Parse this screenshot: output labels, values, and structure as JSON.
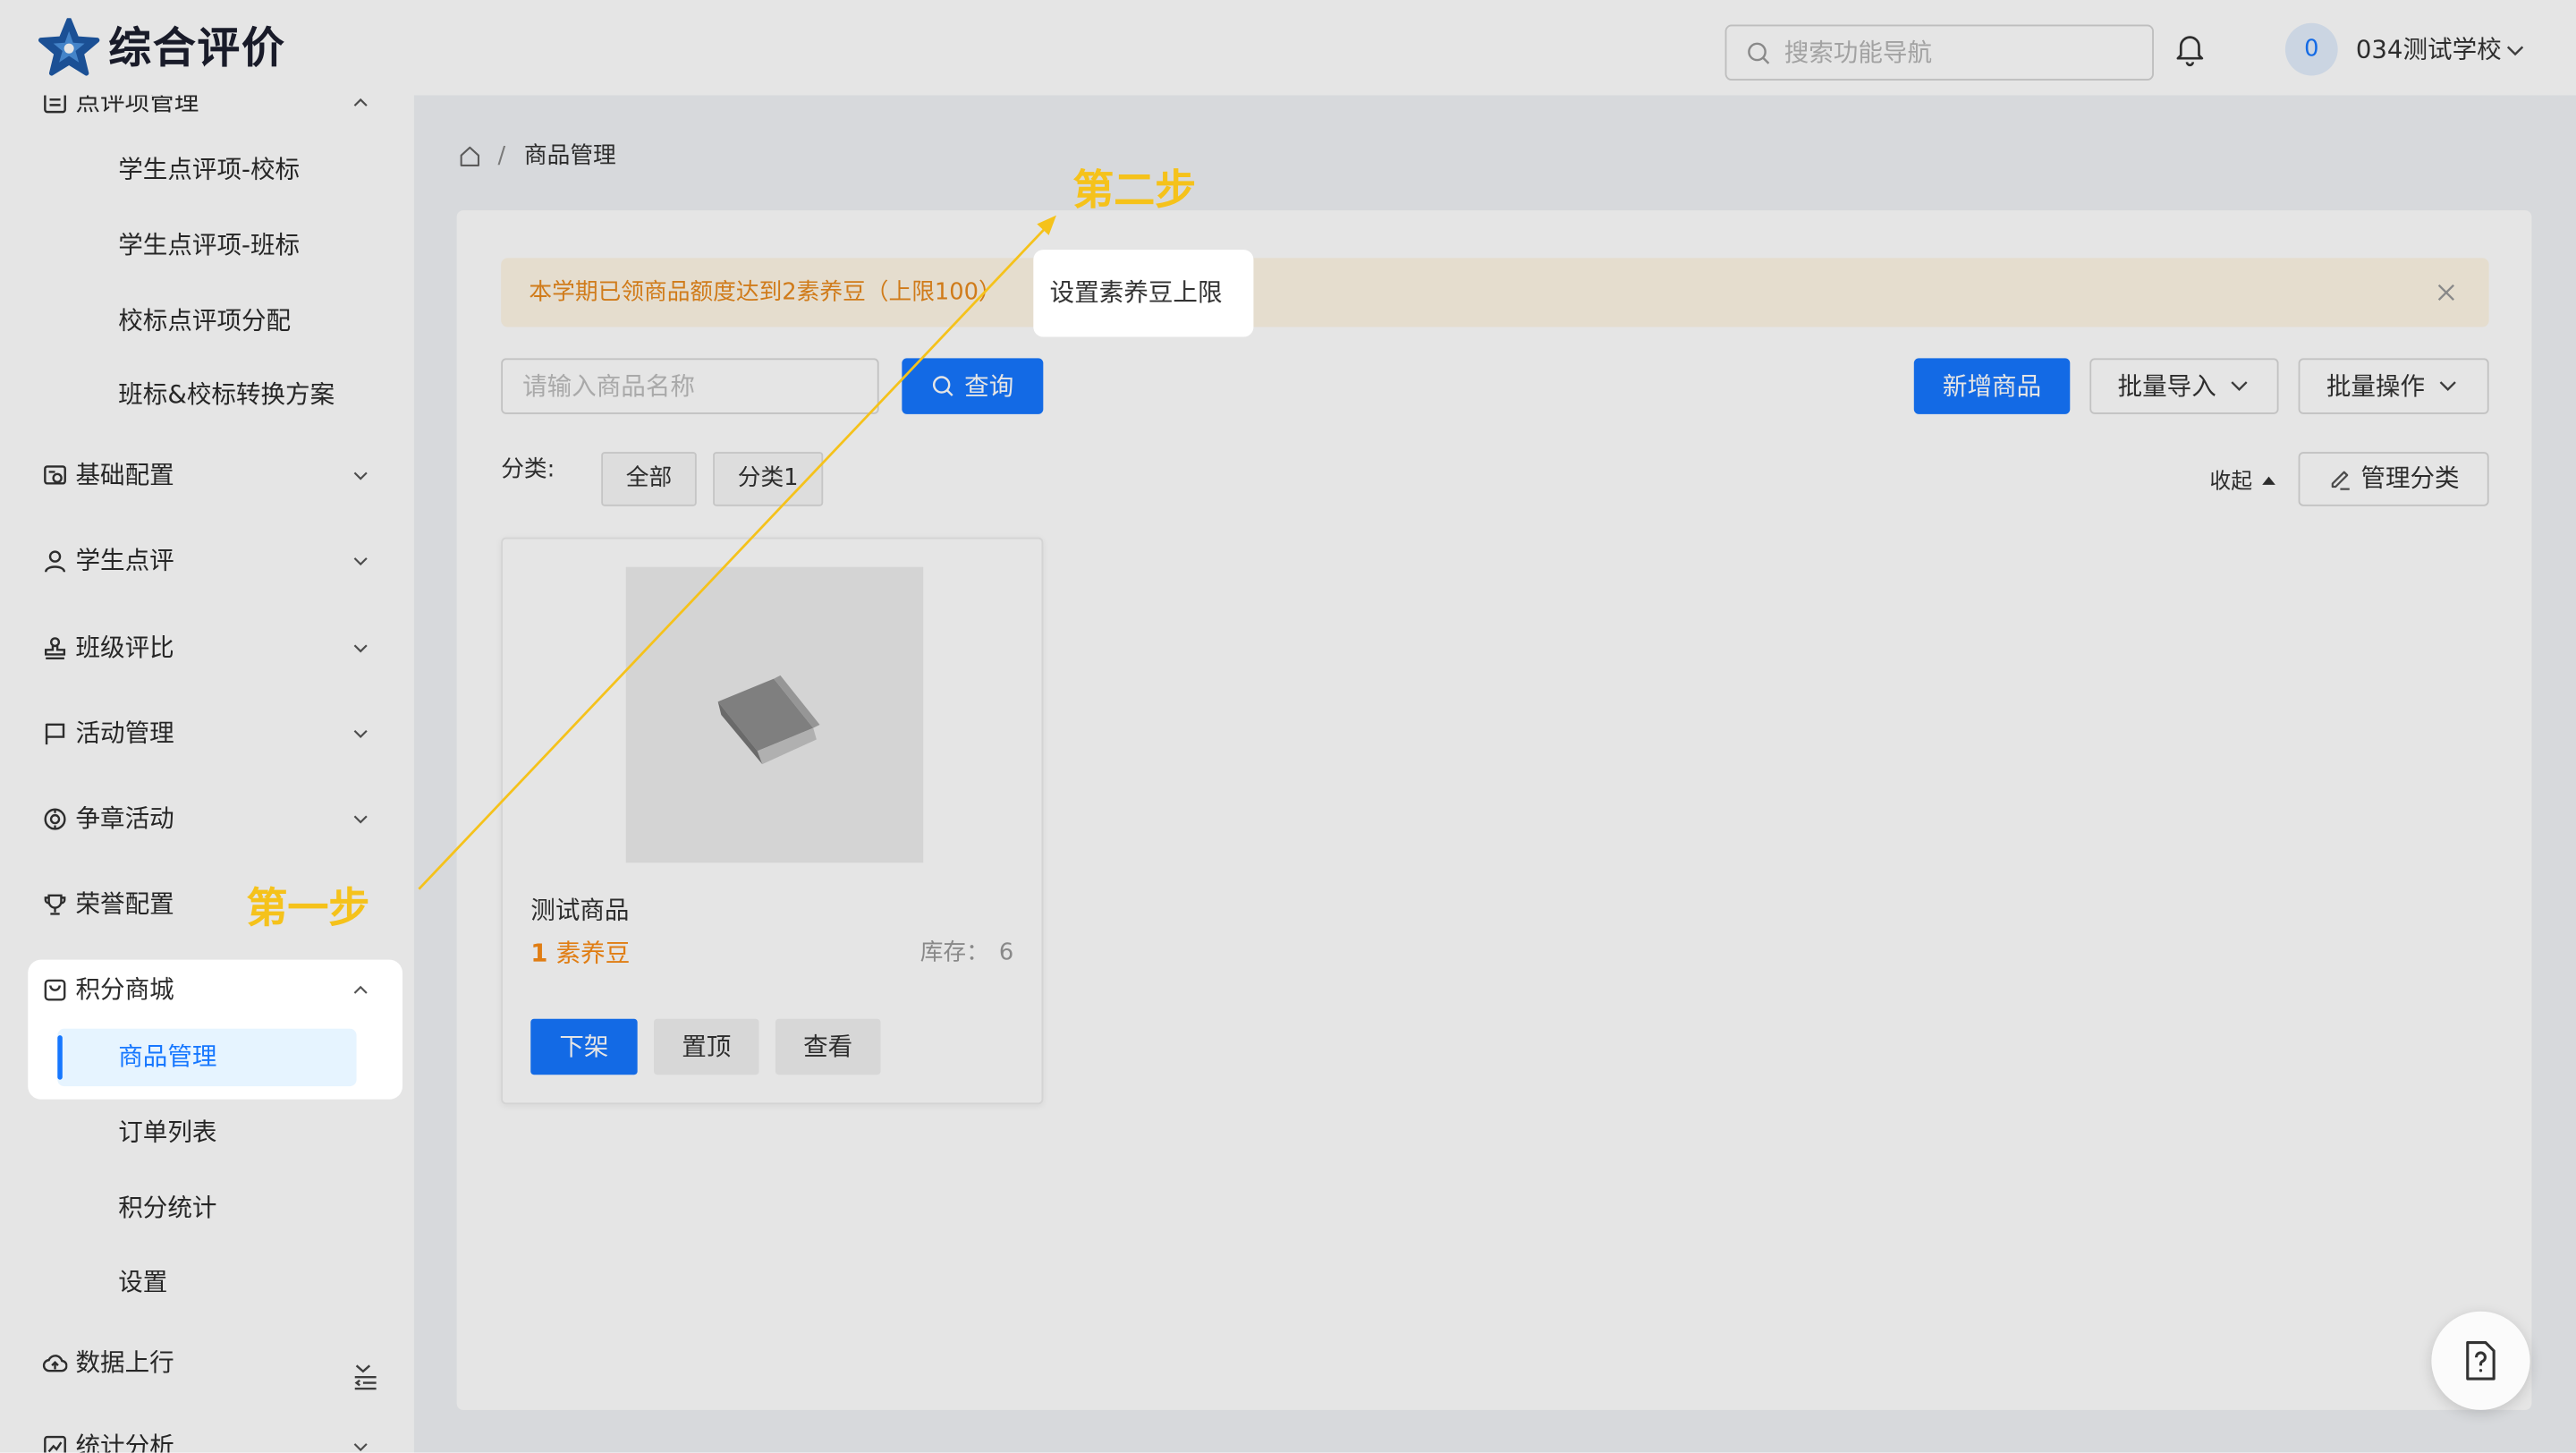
{
  "colors": {
    "accent": "#1677ff",
    "warning": "#fa8c16",
    "annotation": "#f5c21b",
    "selected_bg": "#e6f4ff"
  },
  "header": {
    "logo_icon": "star-logo-icon",
    "app_title": "综合评价",
    "search_icon": "search-icon",
    "search_placeholder": "搜索功能导航",
    "notification_icon": "bell-icon",
    "avatar_text": "0",
    "school_name": "034测试学校",
    "dropdown_icon": "chevron-down-icon"
  },
  "sidebar": {
    "items": [
      {
        "label": "点评项管理",
        "icon": "list-icon",
        "expanded": true
      },
      {
        "label": "学生点评项-校标"
      },
      {
        "label": "学生点评项-班标"
      },
      {
        "label": "校标点评项分配"
      },
      {
        "label": "班标&校标转换方案"
      },
      {
        "label": "基础配置",
        "icon": "settings-icon",
        "expanded": false
      },
      {
        "label": "学生点评",
        "icon": "user-icon",
        "expanded": false
      },
      {
        "label": "班级评比",
        "icon": "stamp-icon",
        "expanded": false
      },
      {
        "label": "活动管理",
        "icon": "flag-icon",
        "expanded": false
      },
      {
        "label": "争章活动",
        "icon": "badge-icon",
        "expanded": false
      },
      {
        "label": "荣誉配置",
        "icon": "trophy-icon"
      },
      {
        "label": "积分商城",
        "icon": "shopping-bag-icon",
        "expanded": true
      },
      {
        "label": "商品管理",
        "selected": true
      },
      {
        "label": "订单列表"
      },
      {
        "label": "积分统计"
      },
      {
        "label": "设置"
      },
      {
        "label": "数据上行",
        "icon": "cloud-upload-icon"
      },
      {
        "label": "统计分析",
        "icon": "chart-icon",
        "expanded": false
      }
    ],
    "collapse_icon": "menu-fold-icon"
  },
  "breadcrumb": {
    "home_icon": "home-icon",
    "separator": "/",
    "current": "商品管理"
  },
  "alert": {
    "text": "本学期已领商品额度达到2素养豆（上限100）",
    "close_icon": "close-icon"
  },
  "toolbar": {
    "search_placeholder": "请输入商品名称",
    "query_label": "查询",
    "add_label": "新增商品",
    "import_label": "批量导入",
    "batch_label": "批量操作"
  },
  "category": {
    "label": "分类:",
    "tags": [
      "全部",
      "分类1"
    ],
    "collapse_label": "收起",
    "manage_label": "管理分类"
  },
  "products": [
    {
      "name": "测试商品",
      "price": "1",
      "unit": "素养豆",
      "stock_label": "库存：",
      "stock": "6",
      "image_icon": "book-icon",
      "actions": [
        "下架",
        "置顶",
        "查看"
      ]
    }
  ],
  "guide": {
    "step1": "第一步",
    "step2": "第二步",
    "tooltip": "设置素养豆上限"
  },
  "help_icon": "help-document-icon"
}
